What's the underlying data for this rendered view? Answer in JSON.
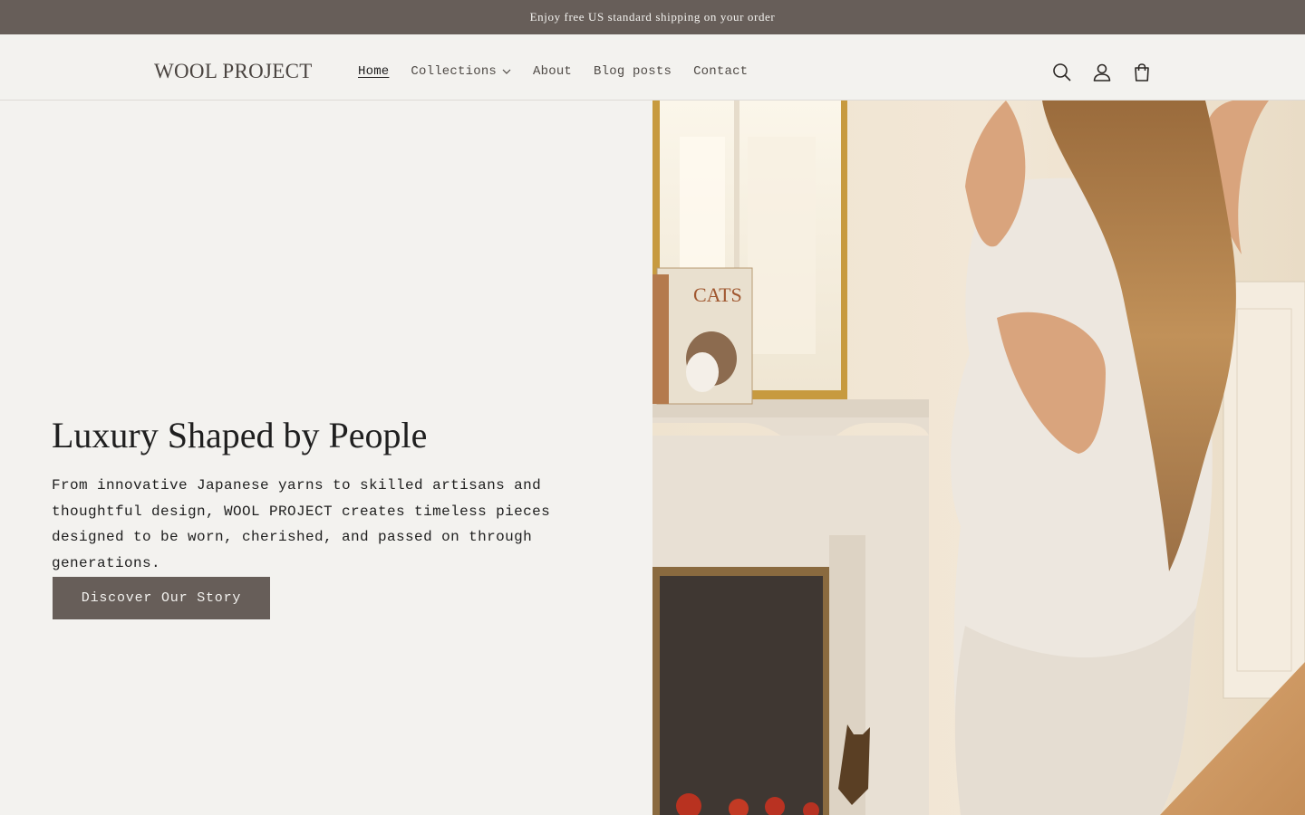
{
  "announcement": {
    "text": "Enjoy free US standard shipping on your order"
  },
  "header": {
    "logo": "WOOL PROJECT",
    "nav": [
      {
        "label": "Home",
        "active": true
      },
      {
        "label": "Collections",
        "has_dropdown": true
      },
      {
        "label": "About"
      },
      {
        "label": "Blog posts"
      },
      {
        "label": "Contact"
      }
    ],
    "icons": [
      "search-icon",
      "account-icon",
      "cart-icon"
    ]
  },
  "hero": {
    "title": "Luxury Shaped by People",
    "text": "From innovative Japanese yarns to skilled artisans and thoughtful design, WOOL PROJECT creates timeless pieces designed to be worn, cherished, and passed on through generations.",
    "button_label": "Discover Our Story",
    "image": {
      "book_title": "CATS"
    }
  },
  "colors": {
    "accent": "#675e59",
    "background": "#f3f2ef",
    "text": "#1f1f1f"
  }
}
